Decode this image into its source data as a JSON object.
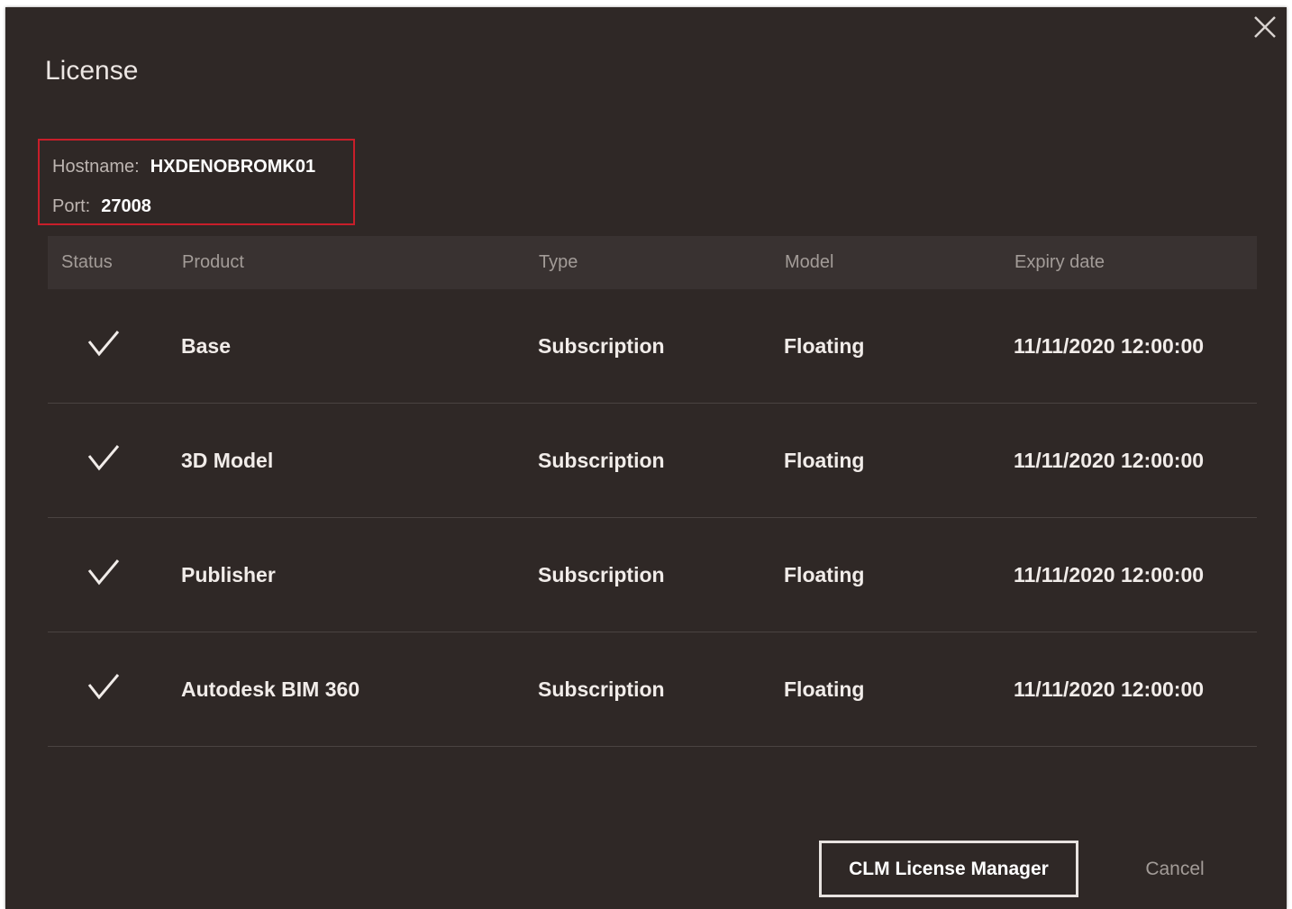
{
  "dialog": {
    "title": "License",
    "close_icon": "close-icon"
  },
  "server": {
    "hostname_label": "Hostname:",
    "hostname_value": "HXDENOBROMK01",
    "port_label": "Port:",
    "port_value": "27008"
  },
  "table": {
    "headers": {
      "status": "Status",
      "product": "Product",
      "type": "Type",
      "model": "Model",
      "expiry": "Expiry date"
    },
    "rows": [
      {
        "status_icon": "check-icon",
        "product": "Base",
        "type": "Subscription",
        "model": "Floating",
        "expiry": "11/11/2020 12:00:00"
      },
      {
        "status_icon": "check-icon",
        "product": "3D Model",
        "type": "Subscription",
        "model": "Floating",
        "expiry": "11/11/2020 12:00:00"
      },
      {
        "status_icon": "check-icon",
        "product": "Publisher",
        "type": "Subscription",
        "model": "Floating",
        "expiry": "11/11/2020 12:00:00"
      },
      {
        "status_icon": "check-icon",
        "product": "Autodesk BIM 360",
        "type": "Subscription",
        "model": "Floating",
        "expiry": "11/11/2020 12:00:00"
      }
    ]
  },
  "footer": {
    "clm_button": "CLM License Manager",
    "cancel_button": "Cancel"
  },
  "colors": {
    "background": "#2f2826",
    "header_row": "#393231",
    "highlight_border": "#c81e2a",
    "text": "#f1ece9",
    "muted_text": "#a39c98"
  }
}
